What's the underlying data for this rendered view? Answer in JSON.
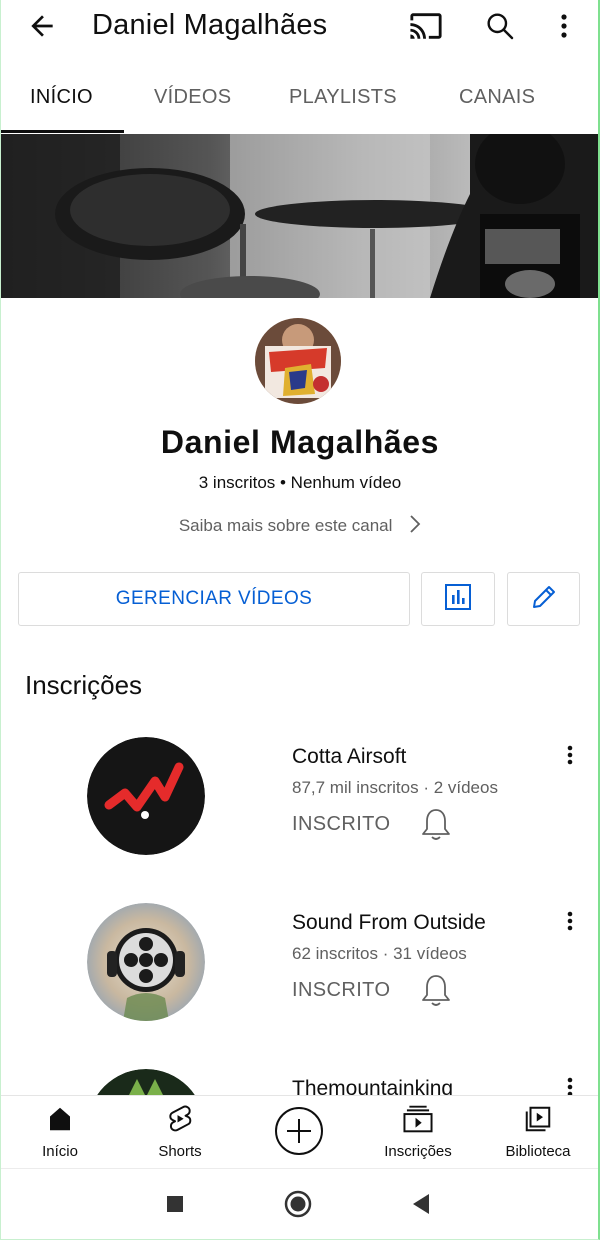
{
  "header": {
    "title": "Daniel Magalhães",
    "icons": [
      "back-arrow-icon",
      "cast-icon",
      "search-icon",
      "more-vert-icon"
    ]
  },
  "tabs": [
    {
      "label": "INÍCIO",
      "active": true
    },
    {
      "label": "VÍDEOS",
      "active": false
    },
    {
      "label": "PLAYLISTS",
      "active": false
    },
    {
      "label": "CANAIS",
      "active": false
    }
  ],
  "channel": {
    "name": "Daniel Magalhães",
    "stats": "3 inscritos • Nenhum vídeo",
    "more_link": "Saiba mais sobre este canal"
  },
  "actions": {
    "manage_label": "GERENCIAR VÍDEOS",
    "accent": "#065fd4"
  },
  "subscriptions": {
    "title": "Inscrições",
    "items": [
      {
        "name": "Cotta Airsoft",
        "meta": "87,7 mil inscritos · 2 vídeos",
        "state": "INSCRITO"
      },
      {
        "name": "Sound From Outside",
        "meta": "62 inscritos · 31 vídeos",
        "state": "INSCRITO"
      },
      {
        "name": "Themountainking"
      }
    ]
  },
  "bottom_nav": {
    "items": [
      {
        "label": "Início",
        "icon": "home-icon",
        "active": true
      },
      {
        "label": "Shorts",
        "icon": "shorts-icon"
      },
      {
        "label": "",
        "icon": "create-plus-icon"
      },
      {
        "label": "Inscrições",
        "icon": "subscriptions-icon"
      },
      {
        "label": "Biblioteca",
        "icon": "library-icon"
      }
    ]
  },
  "system_nav": [
    "recents-square-icon",
    "home-circle-icon",
    "back-triangle-icon"
  ]
}
